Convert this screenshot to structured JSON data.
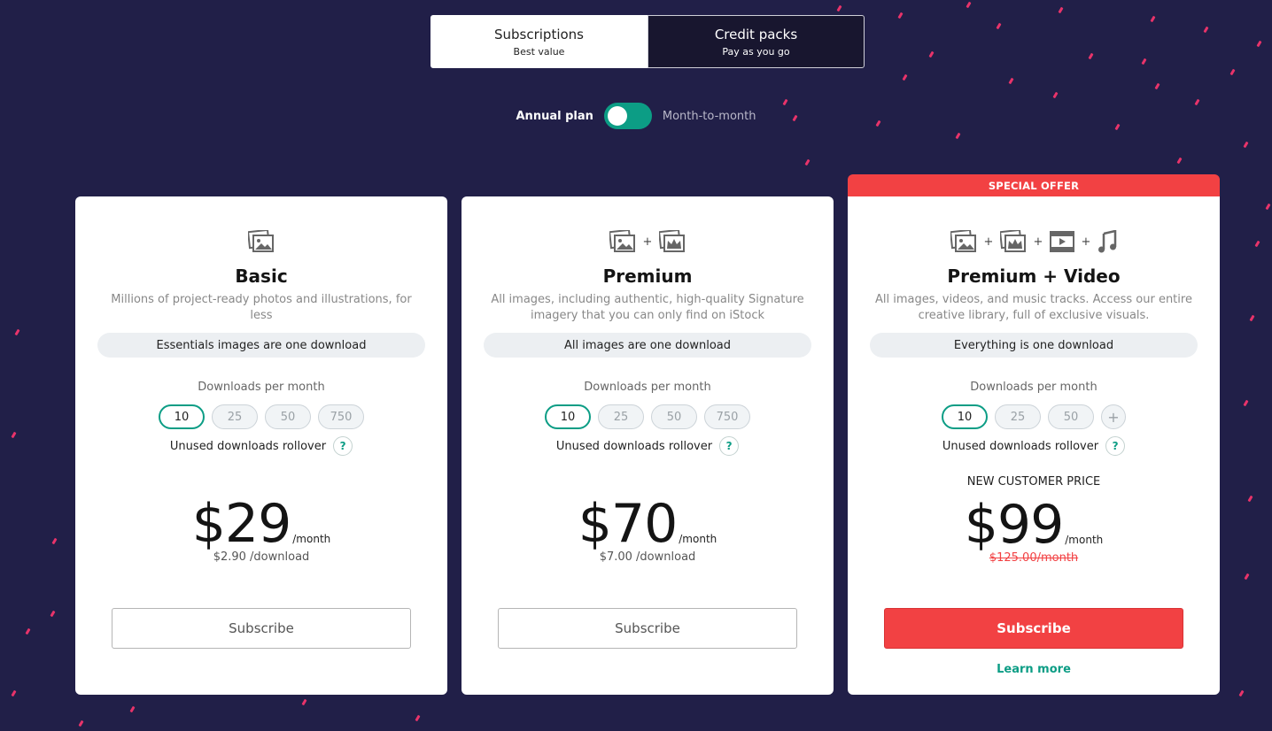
{
  "tabs": [
    {
      "title": "Subscriptions",
      "subtitle": "Best value"
    },
    {
      "title": "Credit packs",
      "subtitle": "Pay as you go"
    }
  ],
  "toggle": {
    "left_label": "Annual plan",
    "right_label": "Month-to-month"
  },
  "special_offer": "SPECIAL OFFER",
  "plans": [
    {
      "name": "Basic",
      "description": "Millions of project-ready photos and illustrations, for less",
      "pill": "Essentials images are one download",
      "downloads_label": "Downloads per month",
      "options": [
        "10",
        "25",
        "50",
        "750"
      ],
      "selected": "10",
      "rollover": "Unused downloads rollover",
      "help": "?",
      "price": "$29",
      "per": "/month",
      "per_download": "$2.90 /download",
      "button": "Subscribe"
    },
    {
      "name": "Premium",
      "description": "All images, including authentic, high-quality Signature imagery that you can only find on iStock",
      "pill": "All images are one download",
      "downloads_label": "Downloads per month",
      "options": [
        "10",
        "25",
        "50",
        "750"
      ],
      "selected": "10",
      "rollover": "Unused downloads rollover",
      "help": "?",
      "price": "$70",
      "per": "/month",
      "per_download": "$7.00 /download",
      "button": "Subscribe"
    },
    {
      "name": "Premium + Video",
      "description": "All images, videos, and music tracks. Access our entire creative library, full of exclusive visuals.",
      "pill": "Everything is one download",
      "downloads_label": "Downloads per month",
      "options": [
        "10",
        "25",
        "50"
      ],
      "more_option": "+",
      "selected": "10",
      "rollover": "Unused downloads rollover",
      "help": "?",
      "new_customer": "NEW CUSTOMER PRICE",
      "price": "$99",
      "per": "/month",
      "old_price": "$125.00/month",
      "button": "Subscribe",
      "learn_more": "Learn more"
    }
  ],
  "icon_plus": "+",
  "colors": {
    "background": "#211f48",
    "accent": "#0c9d85",
    "offer": "#f24143",
    "confetti": "#e8336a"
  }
}
